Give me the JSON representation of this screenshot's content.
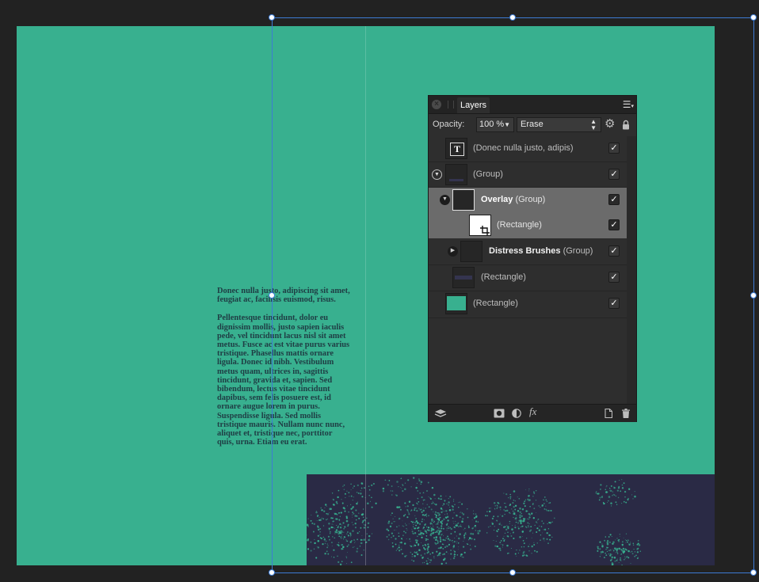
{
  "document": {
    "paragraph1": "Donec nulla justo, adipiscing sit amet, feugiat ac, facilisis euismod, risus.",
    "paragraph2": "Pellentesque tincidunt, dolor eu dignissim mollis, justo sapien iaculis pede, vel tincidunt lacus nisl sit amet metus. Fusce ac est vitae purus varius tristique. Phasellus mattis ornare ligula. Donec id nibh. Vestibulum metus quam, ultrices in, sagittis tincidunt, gravida et, sapien. Sed bibendum, lectus vitae tincidunt dapibus, sem felis posuere est, id ornare augue lorem in purus. Suspendisse ligula. Sed mollis tristique mauris. Nullam nunc nunc, aliquet et, tristique nec, porttitor quis, urna. Etiam eu erat."
  },
  "colors": {
    "canvas_background": "#38b08f",
    "distress_background": "#2a2a45",
    "distress_speckle": "#38b08f",
    "selection": "#3d7bd4"
  },
  "layers_panel": {
    "tab_label": "Layers",
    "opacity_label": "Opacity:",
    "opacity_value": "100 %",
    "blend_mode": "Erase",
    "icons": {
      "close": "close-icon",
      "menu": "panel-menu-icon",
      "settings": "gear-icon",
      "lock": "lock-icon"
    },
    "layers": [
      {
        "name": "(Donec nulla justo, adipis)",
        "type": "text",
        "visible": true
      },
      {
        "name": "(Group)",
        "type": "group",
        "expanded": true,
        "visible": true
      },
      {
        "bold_name": "Overlay",
        "name": "(Group)",
        "type": "group",
        "expanded": true,
        "visible": true,
        "selected": true
      },
      {
        "name": "(Rectangle)",
        "type": "rectangle",
        "visible": true,
        "selected": true
      },
      {
        "bold_name": "Distress Brushes",
        "name": "(Group)",
        "type": "group",
        "expanded": false,
        "visible": true
      },
      {
        "name": "(Rectangle)",
        "type": "rectangle",
        "visible": true
      },
      {
        "name": "(Rectangle)",
        "type": "rectangle",
        "visible": true
      }
    ],
    "footer_icons": [
      "layers-stack-icon",
      "mask-icon",
      "adjustment-icon",
      "fx-icon",
      "new-layer-icon",
      "trash-icon"
    ],
    "fx_label": "fx",
    "check_mark": "✓"
  }
}
